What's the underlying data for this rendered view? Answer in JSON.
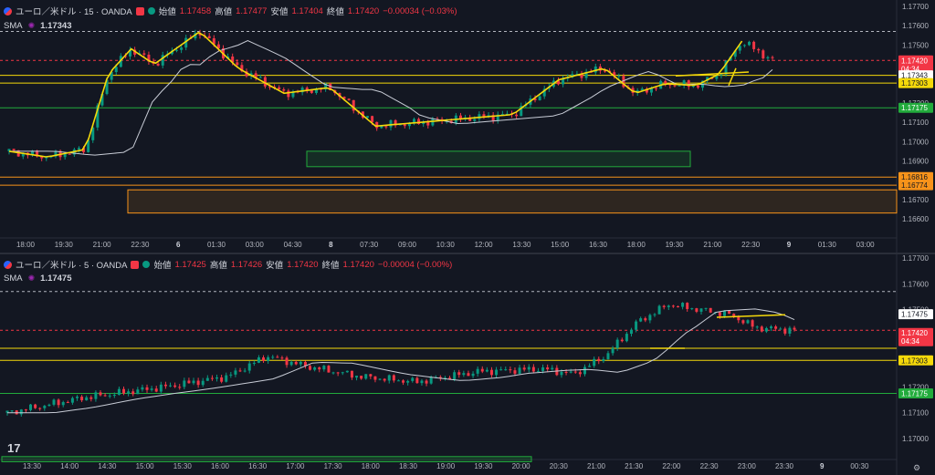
{
  "top": {
    "title": "ユーロ／米ドル · 15 · OANDA",
    "ohlc": [
      {
        "k": "始値",
        "v": "1.17458"
      },
      {
        "k": "高値",
        "v": "1.17477"
      },
      {
        "k": "安値",
        "v": "1.17404"
      },
      {
        "k": "終値",
        "v": "1.17420"
      }
    ],
    "change": "−0.00034 (−0.03%)",
    "sma_label": "SMA",
    "sma_value": "1.17343",
    "price_ticks": [
      "1.17700",
      "1.17600",
      "1.17500",
      "1.17400",
      "1.17300",
      "1.17200",
      "1.17100",
      "1.17000",
      "1.16900",
      "1.16800",
      "1.16700",
      "1.16600"
    ],
    "time_ticks": [
      "18:00",
      "19:30",
      "21:00",
      "22:30",
      "6",
      "01:30",
      "03:00",
      "04:30",
      "8",
      "07:30",
      "09:00",
      "10:30",
      "12:00",
      "13:30",
      "15:00",
      "16:30",
      "18:00",
      "19:30",
      "21:00",
      "22:30",
      "9",
      "01:30",
      "03:00"
    ],
    "labels": [
      {
        "text": "1.17420",
        "sub": "04:34",
        "bg": "#f23645",
        "fg": "#ffffff"
      },
      {
        "text": "1.17343",
        "bg": "#ffffff",
        "fg": "#131722"
      },
      {
        "text": "1.17303",
        "bg": "#f5d90a",
        "fg": "#131722"
      },
      {
        "text": "1.17175",
        "bg": "#22ab3c",
        "fg": "#ffffff"
      },
      {
        "text": "1.16816",
        "bg": "#f7931a",
        "fg": "#131722"
      },
      {
        "text": "1.16774",
        "bg": "#f7931a",
        "fg": "#131722"
      }
    ]
  },
  "bottom": {
    "title": "ユーロ／米ドル · 5 · OANDA",
    "ohlc": [
      {
        "k": "始値",
        "v": "1.17425"
      },
      {
        "k": "高値",
        "v": "1.17426"
      },
      {
        "k": "安値",
        "v": "1.17420"
      },
      {
        "k": "終値",
        "v": "1.17420"
      }
    ],
    "change": "−0.00004 (−0.00%)",
    "sma_label": "SMA",
    "sma_value": "1.17475",
    "price_ticks": [
      "1.17700",
      "1.17600",
      "1.17500",
      "1.17400",
      "1.17300",
      "1.17200",
      "1.17100",
      "1.17000"
    ],
    "time_ticks": [
      "13:30",
      "14:00",
      "14:30",
      "15:00",
      "15:30",
      "16:00",
      "16:30",
      "17:00",
      "17:30",
      "18:00",
      "18:30",
      "19:00",
      "19:30",
      "20:00",
      "20:30",
      "21:00",
      "21:30",
      "22:00",
      "22:30",
      "23:00",
      "23:30",
      "9",
      "00:30"
    ],
    "labels": [
      {
        "text": "1.17475",
        "bg": "#ffffff",
        "fg": "#131722"
      },
      {
        "text": "1.17420",
        "sub": "04:34",
        "bg": "#f23645",
        "fg": "#ffffff"
      },
      {
        "text": "1.17303",
        "bg": "#f5d90a",
        "fg": "#131722"
      },
      {
        "text": "1.17175",
        "bg": "#22ab3c",
        "fg": "#ffffff"
      }
    ]
  },
  "colors": {
    "up": "#089981",
    "down": "#f23645",
    "yellow": "#f5d90a",
    "green": "#22ab3c",
    "orange": "#f7931a",
    "sma": "#c8ccd6"
  }
}
